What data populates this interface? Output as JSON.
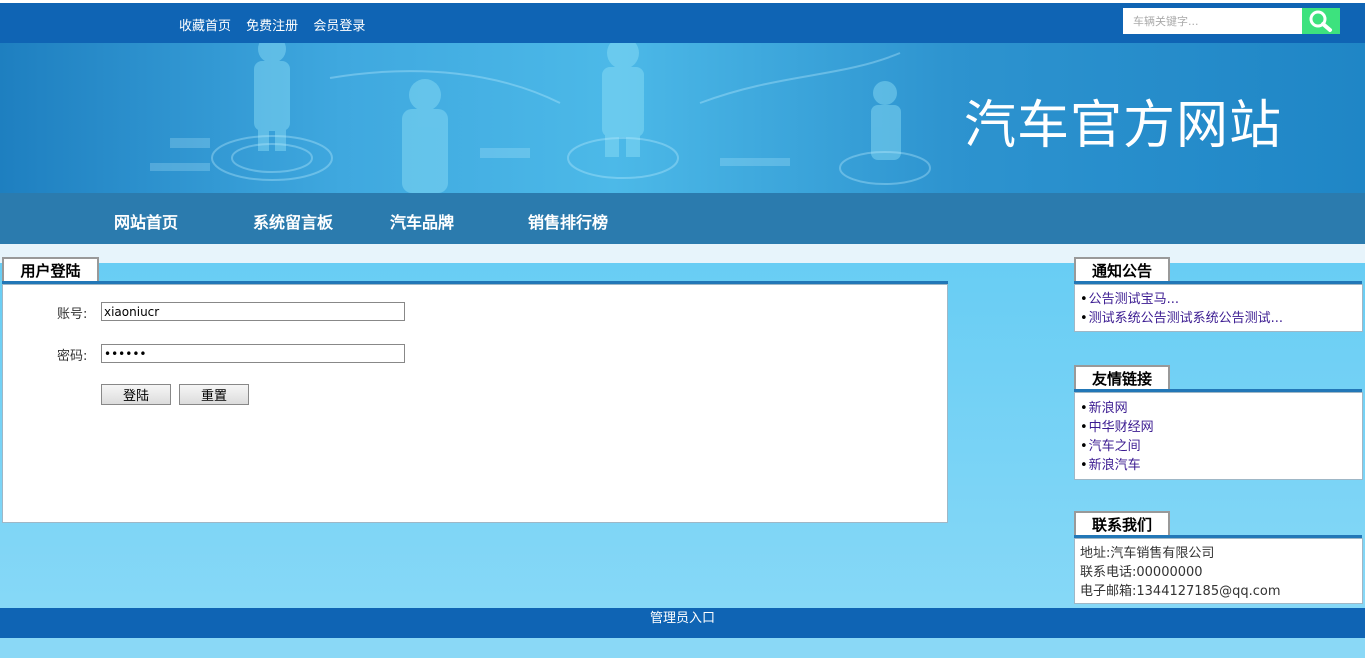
{
  "header": {
    "links": [
      "收藏首页",
      "免费注册",
      "会员登录"
    ],
    "search_placeholder": "车辆关键字...",
    "search_icon": "search-icon"
  },
  "banner": {
    "title": "汽车官方网站"
  },
  "nav": {
    "items": [
      "网站首页",
      "系统留言板",
      "汽车品牌",
      "销售排行榜"
    ]
  },
  "login": {
    "title": "用户登陆",
    "account_label": "账号:",
    "account_value": "xiaoniucr",
    "password_label": "密码:",
    "password_value": "xiaoni",
    "login_button": "登陆",
    "reset_button": "重置"
  },
  "notices": {
    "title": "通知公告",
    "items": [
      "公告测试宝马...",
      "测试系统公告测试系统公告测试..."
    ]
  },
  "links": {
    "title": "友情链接",
    "items": [
      "新浪网",
      "中华财经网",
      "汽车之间",
      "新浪汽车"
    ]
  },
  "contact": {
    "title": "联系我们",
    "address": "地址:汽车销售有限公司",
    "phone": "联系电话:00000000",
    "email": "电子邮箱:1344127185@qq.com"
  },
  "footer": {
    "admin_link": "管理员入口"
  },
  "colors": {
    "topbar": "#0f64b4",
    "nav": "#2b7bae",
    "search_button": "#3de27e",
    "accent_line": "#2277b7"
  }
}
